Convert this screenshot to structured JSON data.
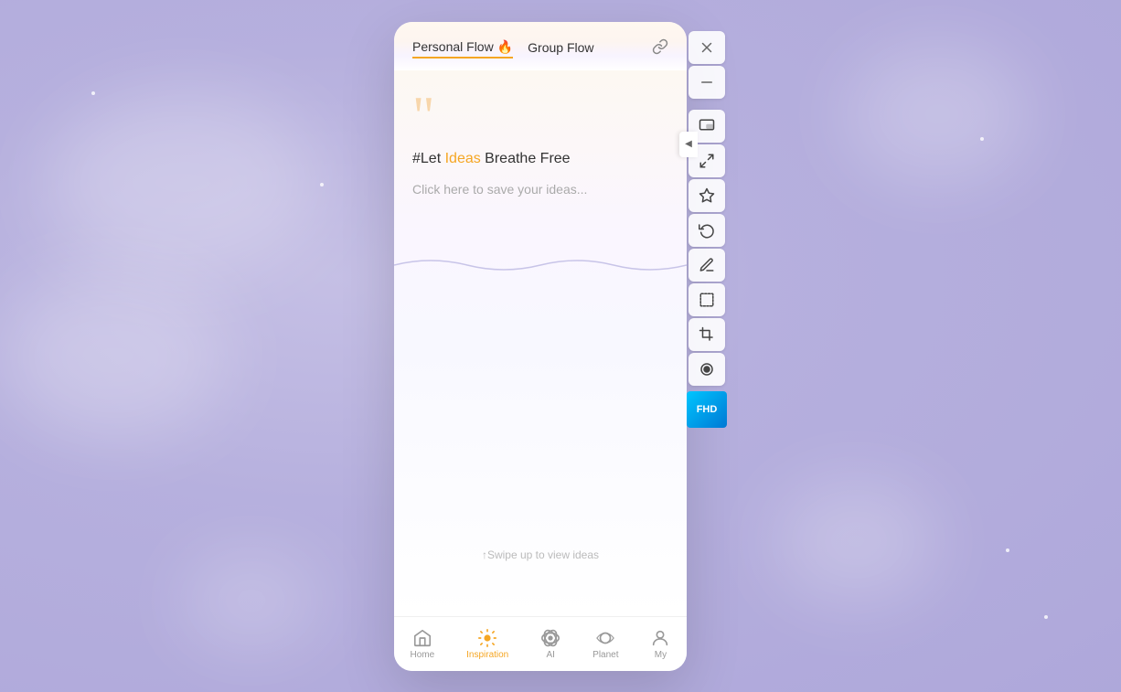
{
  "background": {
    "color": "#b8b0e0"
  },
  "tabs": [
    {
      "id": "personal",
      "label": "Personal Flow",
      "emoji": "🔥",
      "active": true
    },
    {
      "id": "group",
      "label": "Group Flow",
      "emoji": "",
      "active": false
    }
  ],
  "header": {
    "link_icon": "link"
  },
  "content": {
    "quote_mark": "““",
    "tagline_prefix": "#Let ",
    "tagline_highlight": "Ideas",
    "tagline_suffix": " Breathe Free",
    "save_prompt": "Click here to save your ideas...",
    "swipe_hint": "↑Swipe up to view ideas"
  },
  "toolbar": {
    "buttons": [
      {
        "id": "close",
        "icon": "close",
        "label": "close-button"
      },
      {
        "id": "minimize",
        "icon": "minimize",
        "label": "minimize-button"
      },
      {
        "id": "screen",
        "icon": "screen",
        "label": "screen-button"
      },
      {
        "id": "expand",
        "icon": "expand",
        "label": "expand-button"
      },
      {
        "id": "bookmark",
        "icon": "bookmark",
        "label": "bookmark-button"
      },
      {
        "id": "undo",
        "icon": "undo",
        "label": "undo-button"
      },
      {
        "id": "edit",
        "icon": "edit",
        "label": "edit-button"
      },
      {
        "id": "frame",
        "icon": "frame",
        "label": "frame-button"
      },
      {
        "id": "crop",
        "icon": "crop",
        "label": "crop-button"
      },
      {
        "id": "record",
        "icon": "record",
        "label": "record-button"
      }
    ],
    "fhd_label": "FHD"
  },
  "bottom_nav": [
    {
      "id": "home",
      "label": "Home",
      "icon": "home",
      "active": false
    },
    {
      "id": "inspiration",
      "label": "Inspiration",
      "icon": "inspiration",
      "active": true
    },
    {
      "id": "ai",
      "label": "AI",
      "icon": "ai",
      "active": false
    },
    {
      "id": "planet",
      "label": "Planet",
      "icon": "planet",
      "active": false
    },
    {
      "id": "my",
      "label": "My",
      "icon": "my",
      "active": false
    }
  ]
}
